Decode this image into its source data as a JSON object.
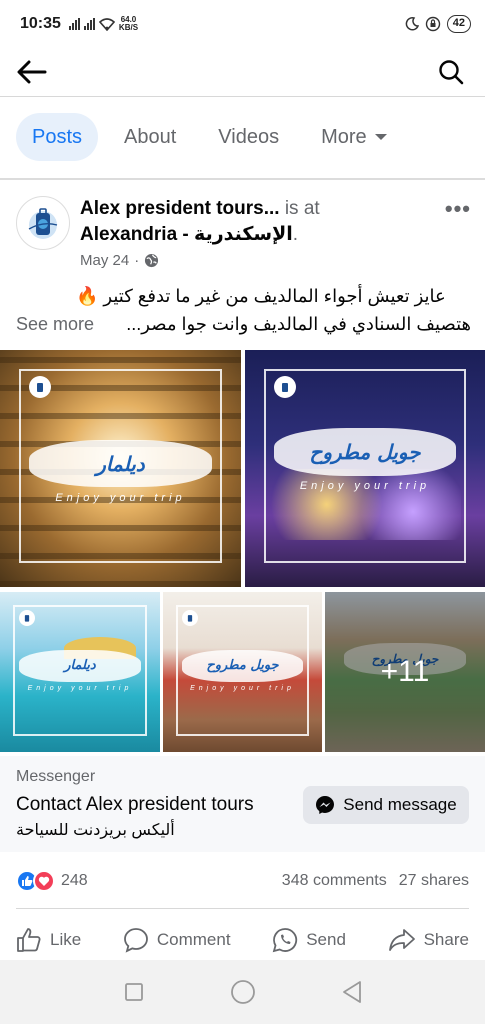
{
  "status_bar": {
    "time": "10:35",
    "net_speed_value": "64.0",
    "net_speed_unit": "KB/S",
    "battery": "42"
  },
  "nav": {
    "back_icon": "arrow-left-icon",
    "search_icon": "search-icon"
  },
  "tabs": [
    {
      "label": "Posts",
      "active": true
    },
    {
      "label": "About",
      "active": false
    },
    {
      "label": "Videos",
      "active": false
    },
    {
      "label": "More",
      "active": false
    }
  ],
  "post": {
    "page_name": "Alex president tours...",
    "is_at": "is at",
    "location": "Alexandria - الإسكندرية",
    "location_suffix": ".",
    "date": "May 24",
    "separator": "·",
    "privacy_icon": "globe-icon",
    "text_line1": "عايز تعيش أجواء المالديف من غير ما تدفع كتير 🔥",
    "see_more": "See more",
    "text_line2": "هتصيف السنادي في المالديف وانت جوا مصر...",
    "photos": [
      {
        "caption": "ديلمار",
        "tagline": "Enjoy your trip"
      },
      {
        "caption": "جويل مطروح",
        "tagline": "Enjoy your trip"
      },
      {
        "caption": "ديلمار",
        "tagline": "Enjoy your trip"
      },
      {
        "caption": "جويل مطروح",
        "tagline": "Enjoy your trip"
      },
      {
        "caption": "جويل مطروح",
        "tagline": ""
      }
    ],
    "more_photos": "+11"
  },
  "messenger": {
    "label": "Messenger",
    "contact": "Contact Alex president tours",
    "arabic_name": "أليكس بريزدنت للسياحة",
    "send_button": "Send message",
    "send_icon": "messenger-icon"
  },
  "engagement": {
    "reaction_count": "248",
    "comments": "348 comments",
    "shares": "27 shares"
  },
  "actions": [
    {
      "label": "Like",
      "icon": "thumbs-up-icon"
    },
    {
      "label": "Comment",
      "icon": "comment-icon"
    },
    {
      "label": "Send",
      "icon": "whatsapp-icon"
    },
    {
      "label": "Share",
      "icon": "share-icon"
    }
  ],
  "colors": {
    "accent": "#1877f2",
    "muted": "#65676b",
    "love": "#f33e58"
  }
}
